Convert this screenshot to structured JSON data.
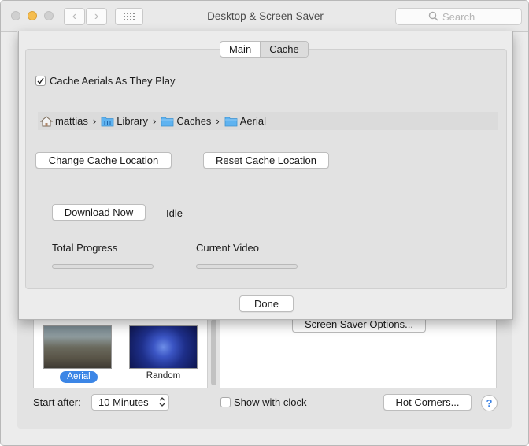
{
  "window": {
    "title": "Desktop & Screen Saver"
  },
  "toolbar": {
    "back_label": "‹",
    "forward_label": "›",
    "search_placeholder": "Search"
  },
  "thumbnails": [
    {
      "label": "Aerial",
      "selected": true
    },
    {
      "label": "Random",
      "selected": false
    }
  ],
  "controls": {
    "screen_saver_options_label": "Screen Saver Options...",
    "start_after_label": "Start after:",
    "start_after_value": "10 Minutes",
    "show_with_clock_label": "Show with clock",
    "show_with_clock_checked": false,
    "hot_corners_label": "Hot Corners...",
    "help_label": "?"
  },
  "sheet": {
    "tabs": [
      {
        "label": "Main",
        "selected": false
      },
      {
        "label": "Cache",
        "selected": true
      }
    ],
    "cache_checkbox_label": "Cache Aerials As They Play",
    "cache_checkbox_checked": true,
    "path": [
      {
        "label": "mattias",
        "icon": "home-icon"
      },
      {
        "label": "Library",
        "icon": "library-folder-icon"
      },
      {
        "label": "Caches",
        "icon": "folder-icon"
      },
      {
        "label": "Aerial",
        "icon": "folder-icon"
      }
    ],
    "path_separator": "›",
    "change_cache_label": "Change Cache Location",
    "reset_cache_label": "Reset Cache Location",
    "download_now_label": "Download Now",
    "status_text": "Idle",
    "total_progress_label": "Total Progress",
    "total_progress_value": 0,
    "current_video_label": "Current Video",
    "current_video_value": 0,
    "done_label": "Done"
  },
  "colors": {
    "accent": "#3c86e6",
    "window_bg": "#ececec",
    "folder": "#5fb3f0"
  }
}
